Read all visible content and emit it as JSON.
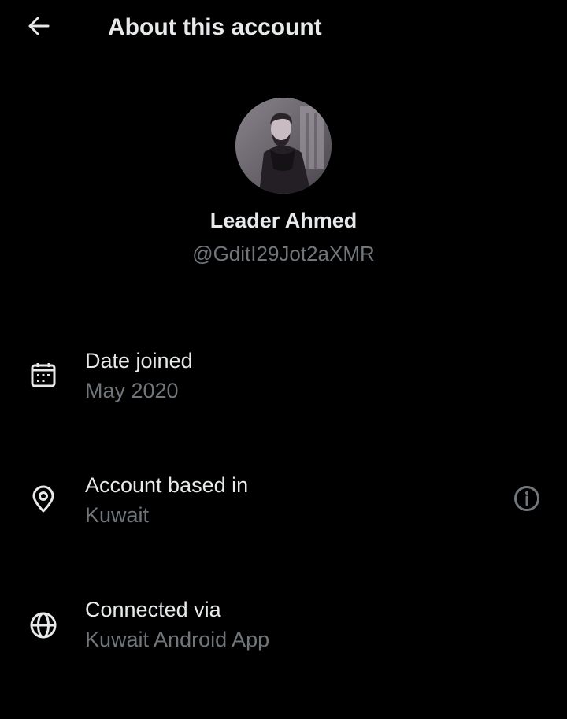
{
  "header": {
    "title": "About this account",
    "back_icon": "arrow-left-icon"
  },
  "profile": {
    "display_name": "Leader Ahmed",
    "handle": "@GditI29Jot2aXMR"
  },
  "rows": [
    {
      "icon": "calendar-icon",
      "label": "Date joined",
      "value": "May 2020"
    },
    {
      "icon": "location-pin-icon",
      "label": "Account based in",
      "value": "Kuwait",
      "trailing_icon": "info-icon"
    },
    {
      "icon": "globe-icon",
      "label": "Connected via",
      "value": "Kuwait Android App"
    }
  ],
  "colors": {
    "background": "#000000",
    "primary_text": "#e7e9ea",
    "secondary_text": "#71767b"
  }
}
